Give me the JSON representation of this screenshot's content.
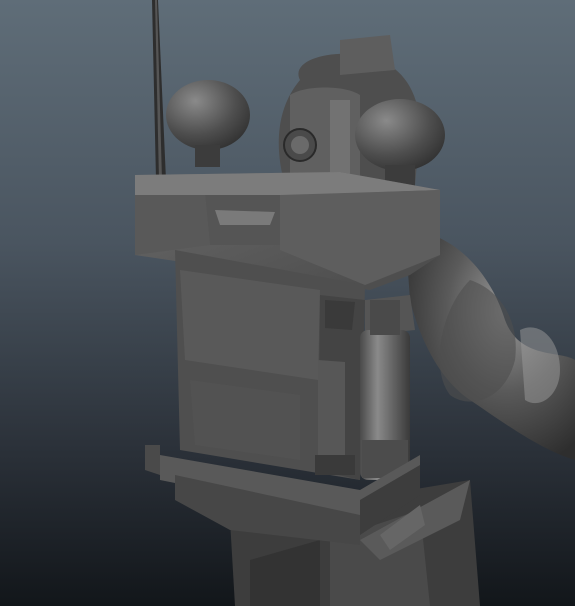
{
  "viewport": {
    "background_top": "#5f6d78",
    "background_bottom": "#12161a"
  },
  "model": {
    "subject": "character-with-backpack-radio",
    "shading": "gray-lambert",
    "colors": {
      "base": "#585858",
      "light": "#7a7a7a",
      "dark": "#363636",
      "shadow": "#262626"
    }
  }
}
